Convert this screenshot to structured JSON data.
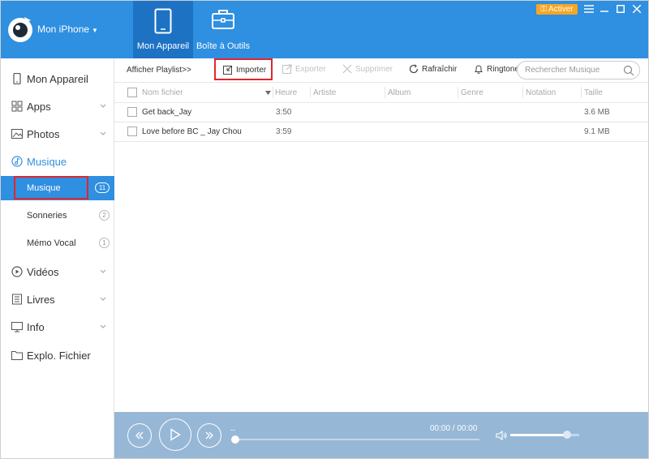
{
  "app": {
    "device_name": "Mon iPhone",
    "top_tabs": [
      {
        "label": "Mon Appareil",
        "icon": "tablet-icon",
        "active": true
      },
      {
        "label": "Boîte à Outils",
        "icon": "toolbox-icon",
        "active": false
      }
    ],
    "activate_label": "Activer",
    "accent_color": "#2f8fe0",
    "activate_color": "#f5a623"
  },
  "sidebar": {
    "items": [
      {
        "label": "Mon Appareil",
        "icon": "device-icon",
        "has_chevron": false
      },
      {
        "label": "Apps",
        "icon": "apps-icon",
        "has_chevron": true
      },
      {
        "label": "Photos",
        "icon": "photos-icon",
        "has_chevron": true
      },
      {
        "label": "Musique",
        "icon": "music-icon",
        "has_chevron": false
      },
      {
        "label": "Vidéos",
        "icon": "video-icon",
        "has_chevron": true
      },
      {
        "label": "Livres",
        "icon": "book-icon",
        "has_chevron": true
      },
      {
        "label": "Info",
        "icon": "info-icon",
        "has_chevron": true
      },
      {
        "label": "Explo. Fichier",
        "icon": "folder-icon",
        "has_chevron": false
      }
    ],
    "music_sub": [
      {
        "label": "Musique",
        "count": "11",
        "active": true
      },
      {
        "label": "Sonneries",
        "count": "2",
        "active": false
      },
      {
        "label": "Mémo Vocal",
        "count": "1",
        "active": false
      }
    ]
  },
  "toolbar": {
    "playlist_label": "Afficher Playlist>>",
    "import_label": "Importer",
    "export_label": "Exporter",
    "delete_label": "Supprimer",
    "refresh_label": "Rafraîchir",
    "ringtone_label": "Ringtone",
    "search_placeholder": "Rechercher Musique"
  },
  "table": {
    "columns": [
      "Nom fichier",
      "Heure",
      "Artiste",
      "Album",
      "Genre",
      "Notation",
      "Taille"
    ],
    "rows": [
      {
        "name": "Get back_Jay",
        "time": "3:50",
        "artist": "",
        "album": "",
        "genre": "",
        "rating": "",
        "size": "3.6 MB"
      },
      {
        "name": "Love before BC _ Jay Chou",
        "time": "3:59",
        "artist": "",
        "album": "",
        "genre": "",
        "rating": "",
        "size": "9.1 MB"
      }
    ]
  },
  "player": {
    "track_text": "--",
    "time_text": "00:00 / 00:00",
    "progress": 0,
    "volume": 0.82
  }
}
